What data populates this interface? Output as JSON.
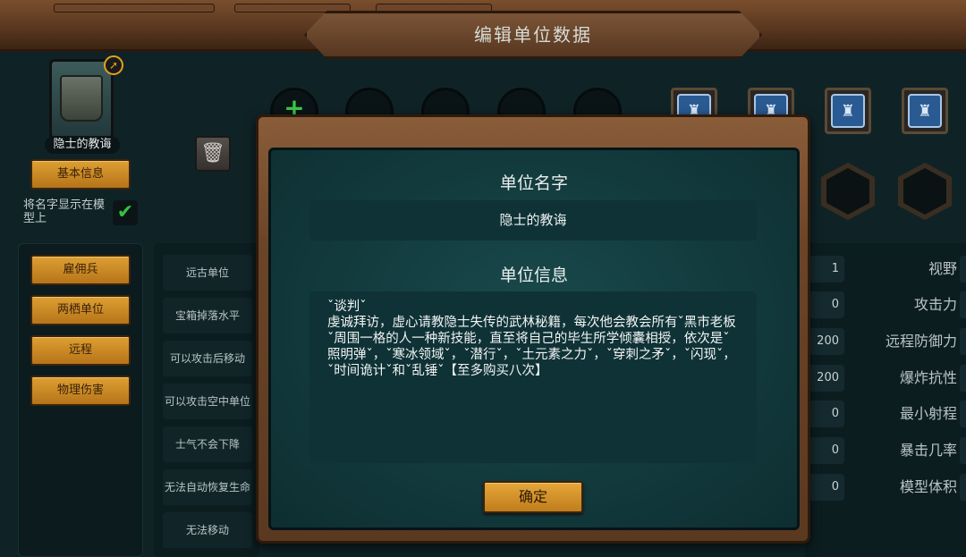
{
  "header": {
    "title": "编辑单位数据"
  },
  "unit": {
    "name": "隐士的教诲"
  },
  "left_panel": {
    "basic_info_button": "基本信息",
    "show_name_on_model_label": "将名字显示在模型上",
    "show_name_checked": true,
    "tags": [
      "雇佣兵",
      "两栖单位",
      "远程",
      "物理伤害"
    ]
  },
  "bool_options": [
    "远古单位",
    "宝箱掉落水平",
    "可以攻击后移动",
    "可以攻击空中单位",
    "士气不会下降",
    "无法自动恢复生命",
    "无法移动"
  ],
  "stats": [
    {
      "label": "视野",
      "value": "1"
    },
    {
      "label": "攻击力",
      "value": "0"
    },
    {
      "label": "远程防御力",
      "value": "200"
    },
    {
      "label": "爆炸抗性",
      "value": "200"
    },
    {
      "label": "最小射程",
      "value": "0"
    },
    {
      "label": "暴击几率",
      "value": "0"
    },
    {
      "label": "模型体积",
      "value": "0"
    }
  ],
  "icons": {
    "trash": "trash-icon",
    "check": "checkmark-icon",
    "badge": "upgrade-badge-icon",
    "plus": "plus-icon"
  },
  "dialog": {
    "name_title": "单位名字",
    "name_value": "隐士的教诲",
    "info_title": "单位信息",
    "info_value": "ˇ谈判ˇ\n虔诚拜访，虚心请教隐士失传的武林秘籍，每次他会教会所有ˇ黑市老板ˇ周围一格的人一种新技能，直至将自己的毕生所学倾囊相授，依次是ˇ照明弹ˇ，ˇ寒冰领域ˇ，ˇ潜行ˇ，ˇ土元素之力ˇ，ˇ穿刺之矛ˇ，ˇ闪现ˇ，ˇ时间诡计ˇ和ˇ乱锤ˇ【至多购买八次】",
    "confirm_button": "确定"
  }
}
